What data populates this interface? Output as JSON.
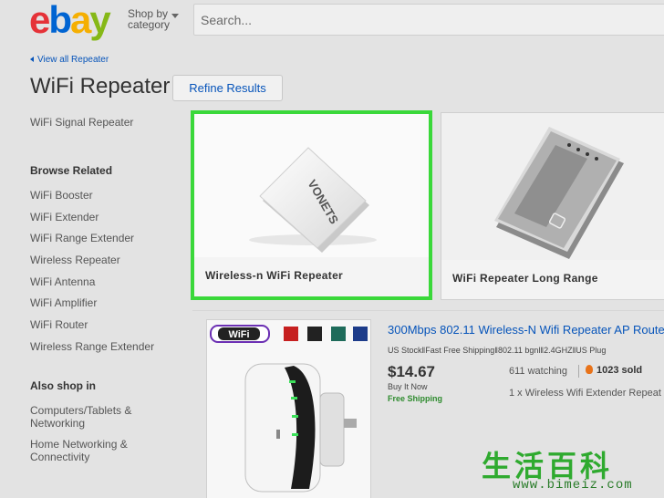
{
  "header": {
    "logo": {
      "e": "e",
      "b": "b",
      "a": "a",
      "y": "y"
    },
    "shop_by_line1": "Shop by",
    "shop_by_line2": "category",
    "search_placeholder": "Search..."
  },
  "back_link": "View all Repeater",
  "page_title": "WiFi Repeater",
  "refine_button": "Refine Results",
  "sidebar": {
    "top_link": "WiFi Signal Repeater",
    "browse_heading": "Browse Related",
    "browse_items": [
      "WiFi Booster",
      "WiFi Extender",
      "WiFi Range Extender",
      "Wireless Repeater",
      "WiFi Antenna",
      "WiFi Amplifier",
      "WiFi Router",
      "Wireless Range Extender"
    ],
    "also_heading": "Also shop in",
    "also_items": [
      {
        "line1": "Computers/Tablets &",
        "line2": "Networking"
      },
      {
        "line1": "Home Networking &",
        "line2": "Connectivity"
      }
    ]
  },
  "cards": [
    {
      "caption": "Wireless-n WiFi Repeater",
      "product_text": "VONETS"
    },
    {
      "caption": "WiFi Repeater Long Range"
    }
  ],
  "listing": {
    "title": "300Mbps 802.11 Wireless-N Wifi Repeater AP Route",
    "subtitle": "US Stock‖Fast Free Shipping‖802.11 bgnl‖2.4GHZ‖US Plug",
    "price": "$14.67",
    "buy_it_now": "Buy It Now",
    "shipping": "Free Shipping",
    "watching": "611 watching",
    "sold": "1023 sold",
    "extra": "1 x Wireless Wifi Extender Repeat",
    "badge_text": "WiFi"
  },
  "watermark": {
    "cn": "生活百科",
    "url": "www.bimeiz.com"
  },
  "colors": {
    "highlight": "#3ad83a",
    "link": "#0654ba",
    "shipping": "#2e8b2e"
  }
}
